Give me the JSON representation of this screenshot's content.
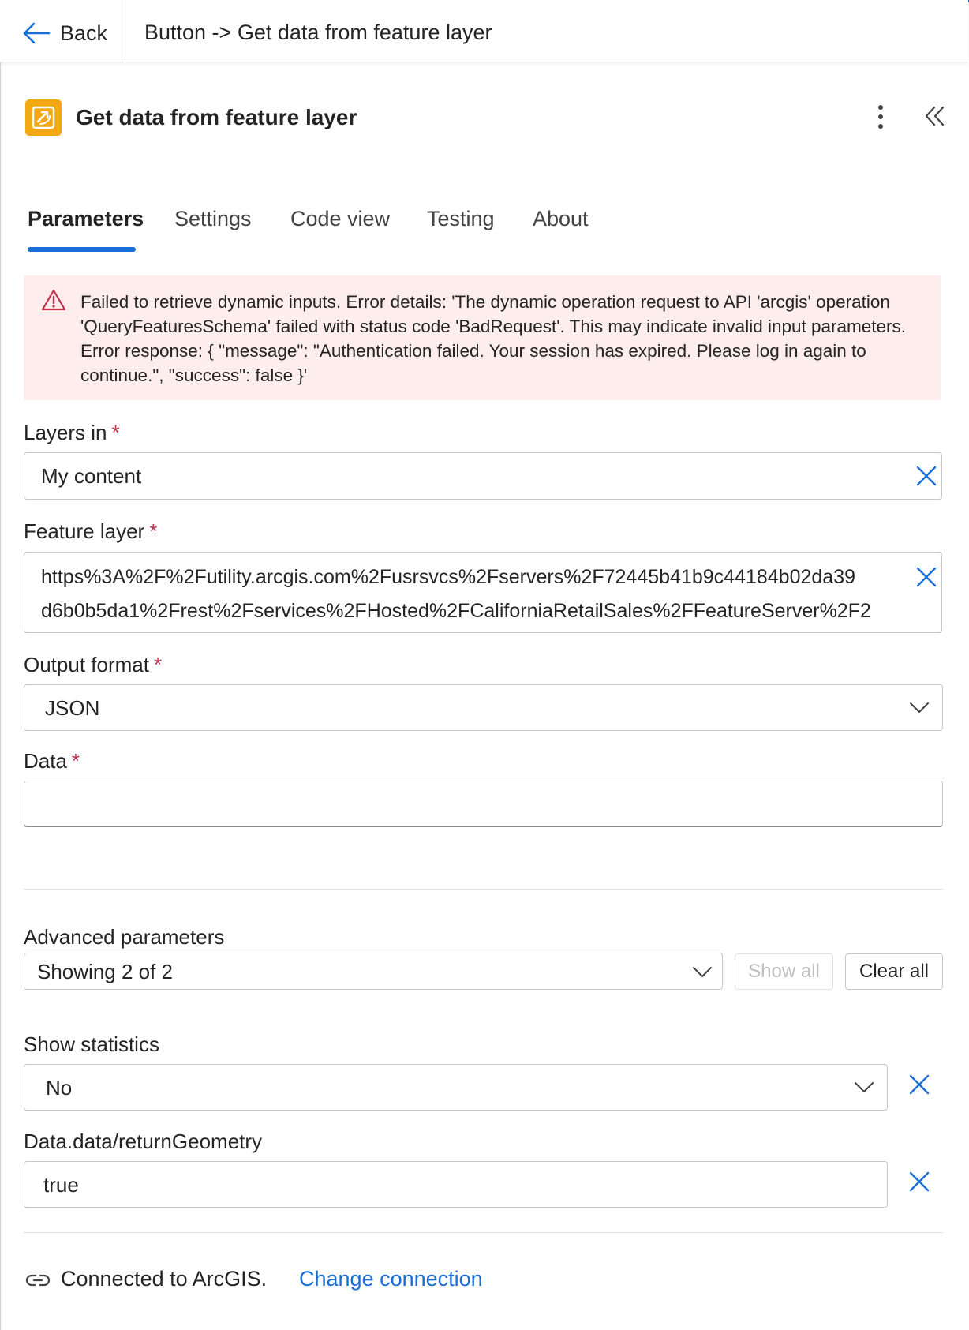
{
  "topbar": {
    "back_label": "Back",
    "breadcrumb": "Button -> Get data from feature layer"
  },
  "header": {
    "title": "Get data from feature layer",
    "accent_color": "#f2a814"
  },
  "tabs": [
    {
      "label": "Parameters",
      "active": true
    },
    {
      "label": "Settings",
      "active": false
    },
    {
      "label": "Code view",
      "active": false
    },
    {
      "label": "Testing",
      "active": false
    },
    {
      "label": "About",
      "active": false
    }
  ],
  "error": {
    "text": "Failed to retrieve dynamic inputs. Error details: 'The dynamic operation request to API 'arcgis' operation 'QueryFeaturesSchema' failed with status code 'BadRequest'. This may indicate invalid input parameters. Error response: { \"message\": \"Authentication failed. Your session has expired. Please log in again to continue.\", \"success\": false }'"
  },
  "fields": {
    "layers_in": {
      "label": "Layers in",
      "required": "*",
      "value": "My content"
    },
    "feature_layer": {
      "label": "Feature layer",
      "required": "*",
      "value_line1": "https%3A%2F%2Futility.arcgis.com%2Fusrsvcs%2Fservers%2F72445b41b9c44184b02da39",
      "value_line2": "d6b0b5da1%2Frest%2Fservices%2FHosted%2FCaliforniaRetailSales%2FFeatureServer%2F2"
    },
    "output_format": {
      "label": "Output format",
      "required": "*",
      "value": "JSON"
    },
    "data": {
      "label": "Data",
      "required": "*",
      "value": ""
    }
  },
  "advanced": {
    "label": "Advanced parameters",
    "value": "Showing 2 of 2",
    "show_all_label": "Show all",
    "clear_all_label": "Clear all"
  },
  "advanced_fields": {
    "show_statistics": {
      "label": "Show statistics",
      "value": "No"
    },
    "return_geometry": {
      "label": "Data.data/returnGeometry",
      "value": "true"
    }
  },
  "footer": {
    "connected_text": "Connected to ArcGIS.",
    "change_link": "Change connection"
  },
  "colors": {
    "brand_blue": "#1a6ed8",
    "error_bg": "#fdeded",
    "error_red": "#c4314b"
  }
}
